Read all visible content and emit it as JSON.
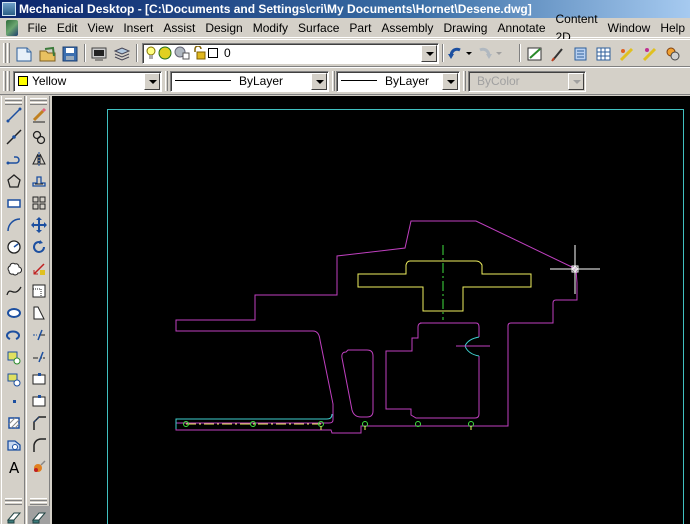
{
  "window": {
    "title": "Mechanical Desktop - [C:\\Documents and Settings\\cri\\My Documents\\Hornet\\Desene.dwg]"
  },
  "menu": {
    "items": [
      {
        "label": "File"
      },
      {
        "label": "Edit"
      },
      {
        "label": "View"
      },
      {
        "label": "Insert"
      },
      {
        "label": "Assist"
      },
      {
        "label": "Design"
      },
      {
        "label": "Modify"
      },
      {
        "label": "Surface"
      },
      {
        "label": "Part"
      },
      {
        "label": "Assembly"
      },
      {
        "label": "Drawing"
      },
      {
        "label": "Annotate"
      },
      {
        "label": "Content 2D"
      },
      {
        "label": "Window"
      },
      {
        "label": "Help"
      }
    ]
  },
  "standard_toolbar": {
    "buttons": [
      "new-icon",
      "open-icon",
      "save-icon",
      "plot-icon",
      "layers-icon"
    ]
  },
  "layer_control": {
    "value": "0",
    "state_icons": [
      "bulb-on-icon",
      "sun-freeze-icon",
      "viewport-freeze-icon",
      "lock-open-icon"
    ]
  },
  "right_toolbar": {
    "buttons": [
      "undo-icon",
      "redo-icon",
      "properties-icon",
      "match-properties-icon",
      "design-center-icon",
      "tool-palette-icon",
      "markup-icon",
      "markup-2-icon",
      "block-editor-icon"
    ]
  },
  "properties_toolbar": {
    "color": {
      "value": "Yellow",
      "swatch": "#ffff00"
    },
    "linetype": {
      "value": "ByLayer"
    },
    "lineweight": {
      "value": "ByLayer"
    },
    "plotstyle": {
      "value": "ByColor",
      "disabled": true
    }
  },
  "draw_toolbar": {
    "tools": [
      "line-icon",
      "construction-line-icon",
      "polyline-icon",
      "polygon-icon",
      "rectangle-icon",
      "arc-icon",
      "circle-icon",
      "revision-cloud-icon",
      "spline-icon",
      "ellipse-icon",
      "ellipse-arc-icon",
      "insert-block-icon",
      "make-block-icon",
      "point-icon",
      "hatch-icon",
      "region-icon",
      "multiline-text-icon"
    ]
  },
  "modify_toolbar": {
    "tools": [
      "erase-icon",
      "copy-icon",
      "mirror-icon",
      "offset-icon",
      "array-icon",
      "move-icon",
      "rotate-icon",
      "scale-icon",
      "stretch-icon",
      "trim-icon",
      "extend-icon",
      "break-at-point-icon",
      "break-icon",
      "join-icon",
      "chamfer-icon",
      "fillet-icon",
      "explode-icon"
    ]
  },
  "drawing": {
    "colors": {
      "background": "#000000",
      "border": "#40c0c0",
      "outline": "#c040c0",
      "part": "#f0f060",
      "centerline": "#40e040",
      "edge": "#40d0d0",
      "holes": "#40e040",
      "crosshair": "#ffffff"
    }
  }
}
